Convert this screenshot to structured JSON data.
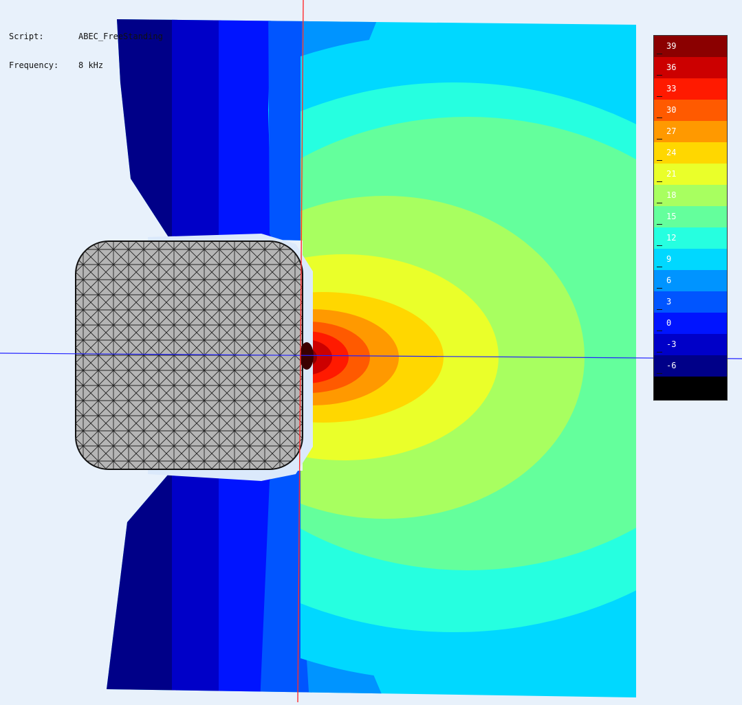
{
  "info": {
    "script_label": "Script:",
    "script_value": "ABEC_FreeStanding",
    "frequency_label": "Frequency:",
    "frequency_value": "8 kHz"
  },
  "colorbar": {
    "levels": [
      {
        "label": "39",
        "color": "#8b0000"
      },
      {
        "label": "36",
        "color": "#cc0000"
      },
      {
        "label": "33",
        "color": "#ff1a00"
      },
      {
        "label": "30",
        "color": "#ff5a00"
      },
      {
        "label": "27",
        "color": "#ff9900"
      },
      {
        "label": "24",
        "color": "#ffd700"
      },
      {
        "label": "21",
        "color": "#eaff2a"
      },
      {
        "label": "18",
        "color": "#a8ff60"
      },
      {
        "label": "15",
        "color": "#64ff9c"
      },
      {
        "label": "12",
        "color": "#26ffe0"
      },
      {
        "label": "9",
        "color": "#00d8ff"
      },
      {
        "label": "6",
        "color": "#0094ff"
      },
      {
        "label": "3",
        "color": "#0055ff"
      },
      {
        "label": "0",
        "color": "#0014ff"
      },
      {
        "label": "-3",
        "color": "#0000c8"
      },
      {
        "label": "-6",
        "color": "#000088"
      },
      {
        "label": "",
        "color": "#000000"
      }
    ]
  }
}
